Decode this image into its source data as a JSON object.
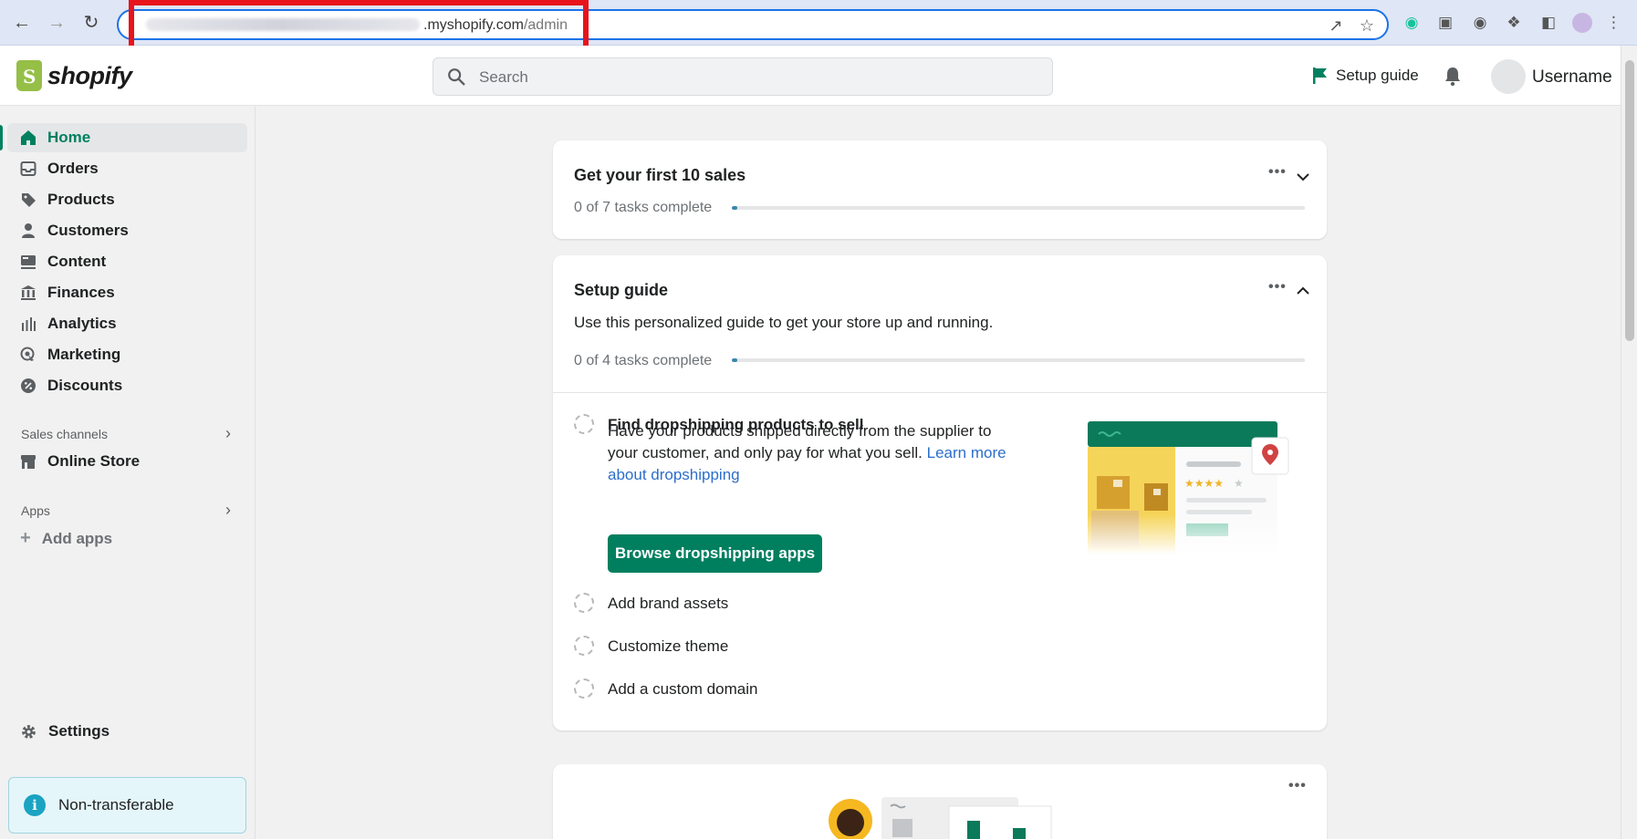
{
  "browser": {
    "url_visible": ".myshopify.com",
    "url_path": "/admin"
  },
  "header": {
    "logo_text": "shopify",
    "search_placeholder": "Search",
    "setup_guide_label": "Setup guide",
    "username": "Username"
  },
  "sidebar": {
    "items": [
      {
        "label": "Home",
        "icon": "home-icon",
        "active": true
      },
      {
        "label": "Orders",
        "icon": "inbox-icon"
      },
      {
        "label": "Products",
        "icon": "tag-icon"
      },
      {
        "label": "Customers",
        "icon": "person-icon"
      },
      {
        "label": "Content",
        "icon": "content-icon"
      },
      {
        "label": "Finances",
        "icon": "bank-icon"
      },
      {
        "label": "Analytics",
        "icon": "bar-chart-icon"
      },
      {
        "label": "Marketing",
        "icon": "target-icon"
      },
      {
        "label": "Discounts",
        "icon": "discount-icon"
      }
    ],
    "sales_channels_label": "Sales channels",
    "online_store_label": "Online Store",
    "apps_label": "Apps",
    "add_apps_label": "Add apps",
    "settings_label": "Settings",
    "notice_text": "Non-transferable"
  },
  "first_sales_card": {
    "title": "Get your first 10 sales",
    "progress_text": "0 of 7 tasks complete",
    "progress": 0
  },
  "setup_guide_card": {
    "title": "Setup guide",
    "subtitle": "Use this personalized guide to get your store up and running.",
    "progress_text": "0 of 4 tasks complete",
    "progress": 0,
    "tasks": [
      {
        "label": "Find dropshipping products to sell",
        "expanded": true
      },
      {
        "label": "Add brand assets"
      },
      {
        "label": "Customize theme"
      },
      {
        "label": "Add a custom domain"
      }
    ],
    "expanded_task": {
      "description": "Have your products shipped directly from the supplier to your customer, and only pay for what you sell.",
      "link_text": "Learn more about dropshipping",
      "button_label": "Browse dropshipping apps"
    }
  },
  "colors": {
    "accent_green": "#008060",
    "progress_blue": "#3a87ad",
    "highlight_red": "#e8141b"
  }
}
